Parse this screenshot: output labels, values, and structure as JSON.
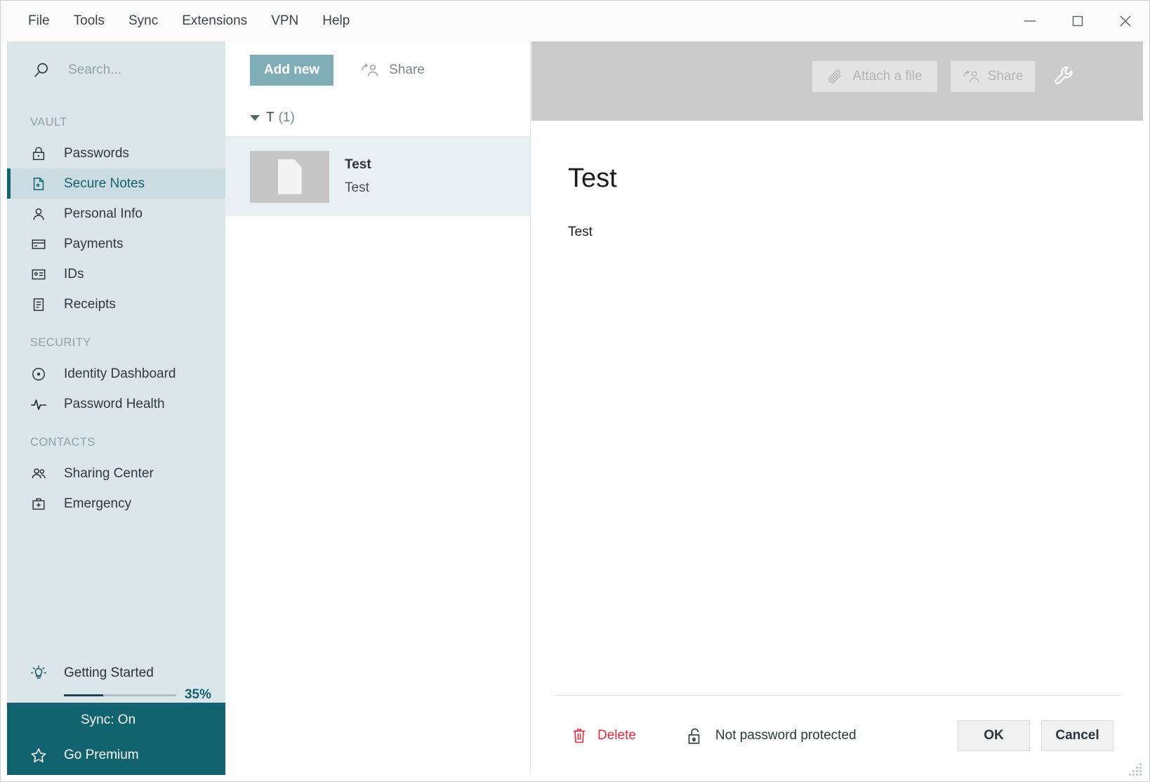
{
  "window": {
    "menu": [
      "File",
      "Tools",
      "Sync",
      "Extensions",
      "VPN",
      "Help"
    ],
    "controls": {
      "minimize": "minimize-button",
      "maximize": "maximize-button",
      "close": "close-button"
    }
  },
  "sidebar": {
    "search": {
      "placeholder": "Search..."
    },
    "sections": [
      {
        "label": "VAULT",
        "items": [
          {
            "label": "Passwords",
            "icon": "lock-icon",
            "active": false
          },
          {
            "label": "Secure Notes",
            "icon": "note-icon",
            "active": true
          },
          {
            "label": "Personal Info",
            "icon": "person-icon",
            "active": false
          },
          {
            "label": "Payments",
            "icon": "card-icon",
            "active": false
          },
          {
            "label": "IDs",
            "icon": "id-card-icon",
            "active": false
          },
          {
            "label": "Receipts",
            "icon": "receipt-icon",
            "active": false
          }
        ]
      },
      {
        "label": "SECURITY",
        "items": [
          {
            "label": "Identity Dashboard",
            "icon": "target-icon",
            "active": false
          },
          {
            "label": "Password Health",
            "icon": "pulse-icon",
            "active": false
          }
        ]
      },
      {
        "label": "CONTACTS",
        "items": [
          {
            "label": "Sharing Center",
            "icon": "people-icon",
            "active": false
          },
          {
            "label": "Emergency",
            "icon": "briefcase-icon",
            "active": false
          }
        ]
      }
    ],
    "getting_started": {
      "label": "Getting Started",
      "percent_label": "35%",
      "percent_value": 35,
      "icon": "lightbulb-icon"
    },
    "bottom": {
      "sync_label": "Sync: On",
      "premium_label": "Go Premium",
      "premium_icon": "star-icon"
    }
  },
  "list_panel": {
    "add_new_label": "Add new",
    "share_label": "Share",
    "group": {
      "name": "T",
      "count": "(1)"
    },
    "items": [
      {
        "title": "Test",
        "subtitle": "Test",
        "icon": "document-thumbnail",
        "selected": true
      }
    ]
  },
  "detail": {
    "attach_label": "Attach a file",
    "share_label": "Share",
    "wrench_icon": "wrench-icon",
    "title": "Test",
    "body": "Test",
    "footer": {
      "delete_label": "Delete",
      "protection_label": "Not password protected",
      "ok_label": "OK",
      "cancel_label": "Cancel"
    }
  },
  "colors": {
    "accent_teal": "#11646f",
    "sidebar_bg": "#dbe6ea",
    "add_new_bg": "#7fadb8",
    "delete_red": "#e4293b",
    "header_gray": "#cbcbcb"
  }
}
